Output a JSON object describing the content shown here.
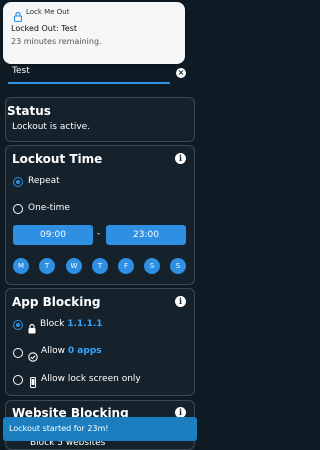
{
  "notification": {
    "app_name": "Lock Me Out",
    "title": "Locked Out: Test",
    "body": "23 minutes remaining."
  },
  "name_field": {
    "value": "Test"
  },
  "status": {
    "title": "Status",
    "text": "Lockout is active."
  },
  "lockout_time": {
    "title": "Lockout Time",
    "repeat_label": "Repeat",
    "onetime_label": "One-time",
    "start_time": "09:00",
    "separator": "-",
    "end_time": "23:00",
    "days": [
      "M",
      "T",
      "W",
      "T",
      "F",
      "S",
      "S"
    ]
  },
  "app_blocking": {
    "title": "App Blocking",
    "block_prefix": "Block",
    "block_value": "1.1.1.1",
    "allow_prefix": "Allow",
    "allow_value": "0 apps",
    "lockscreen_label": "Allow lock screen only"
  },
  "website_blocking": {
    "title": "Website Blocking",
    "partial": "Block 5 websites"
  },
  "toast": {
    "text": "Lockout started for 23m!"
  },
  "colors": {
    "accent": "#2e8fe3",
    "background": "#0f1b24",
    "card": "#15222c"
  }
}
